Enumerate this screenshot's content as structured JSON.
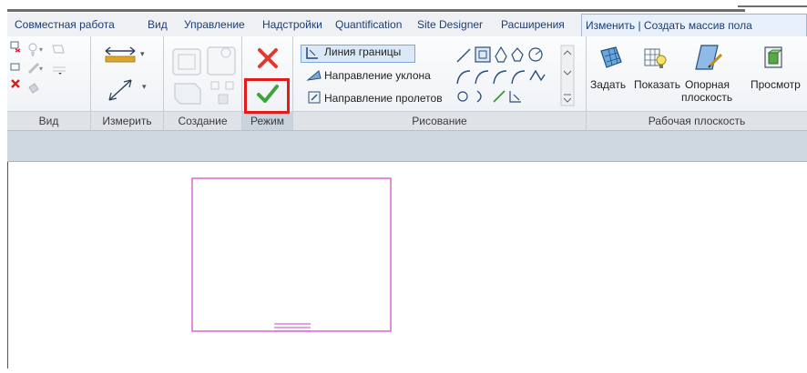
{
  "tabs": [
    {
      "label": "Совместная работа"
    },
    {
      "label": "Вид"
    },
    {
      "label": "Управление"
    },
    {
      "label": "Надстройки"
    },
    {
      "label": "Quantification"
    },
    {
      "label": "Site Designer"
    },
    {
      "label": "Расширения"
    },
    {
      "label": "Изменить | Создать массив пола"
    }
  ],
  "panels": {
    "view": {
      "label": "Вид"
    },
    "measure": {
      "label": "Измерить"
    },
    "create": {
      "label": "Создание"
    },
    "mode": {
      "label": "Режим"
    },
    "draw": {
      "label": "Рисование"
    },
    "workplane": {
      "label": "Рабочая плоскость"
    }
  },
  "draw": {
    "boundary_line": "Линия границы",
    "slope_arrow": "Направление уклона",
    "span_direction": "Направление пролетов"
  },
  "workplane": {
    "set": "Задать",
    "show": "Показать",
    "ref_plane_1": "Опорная",
    "ref_plane_2": "плоскость",
    "viewer": "Просмотр"
  },
  "colors": {
    "accent_red": "#e21b1b",
    "sketch_magenta": "#d66ad6",
    "confirm_green": "#3fa23f",
    "cancel_red": "#e03a2f"
  }
}
